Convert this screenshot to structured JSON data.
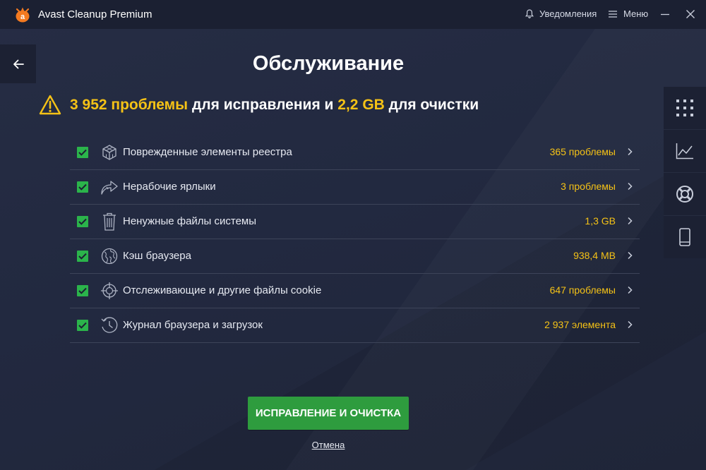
{
  "titlebar": {
    "app_title": "Avast Cleanup Premium",
    "notifications_label": "Уведомления",
    "menu_label": "Меню"
  },
  "page": {
    "title": "Обслуживание"
  },
  "summary": {
    "problems_count": "3 952 проблемы",
    "text_1": " для исправления и ",
    "size": "2,2 GB",
    "text_2": " для очистки"
  },
  "items": [
    {
      "icon": "registry-cube-icon",
      "label": "Поврежденные элементы реестра",
      "value": "365 проблемы",
      "checked": true
    },
    {
      "icon": "broken-shortcut-icon",
      "label": "Нерабочие ярлыки",
      "value": "3 проблемы",
      "checked": true
    },
    {
      "icon": "trash-icon",
      "label": "Ненужные файлы системы",
      "value": "1,3 GB",
      "checked": true
    },
    {
      "icon": "globe-icon",
      "label": "Кэш браузера",
      "value": "938,4 MB",
      "checked": true
    },
    {
      "icon": "crosshair-icon",
      "label": "Отслеживающие и другие файлы cookie",
      "value": "647 проблемы",
      "checked": true
    },
    {
      "icon": "history-clock-icon",
      "label": "Журнал браузера и загрузок",
      "value": "2 937 элемента",
      "checked": true
    }
  ],
  "actions": {
    "primary_label": "ИСПРАВЛЕНИЕ И ОЧИСТКА",
    "cancel_label": "Отмена"
  },
  "colors": {
    "accent_yellow": "#f5c216",
    "button_green": "#2e9c3e",
    "checkbox_green": "#2bb44b",
    "brand_orange": "#f47a20"
  }
}
